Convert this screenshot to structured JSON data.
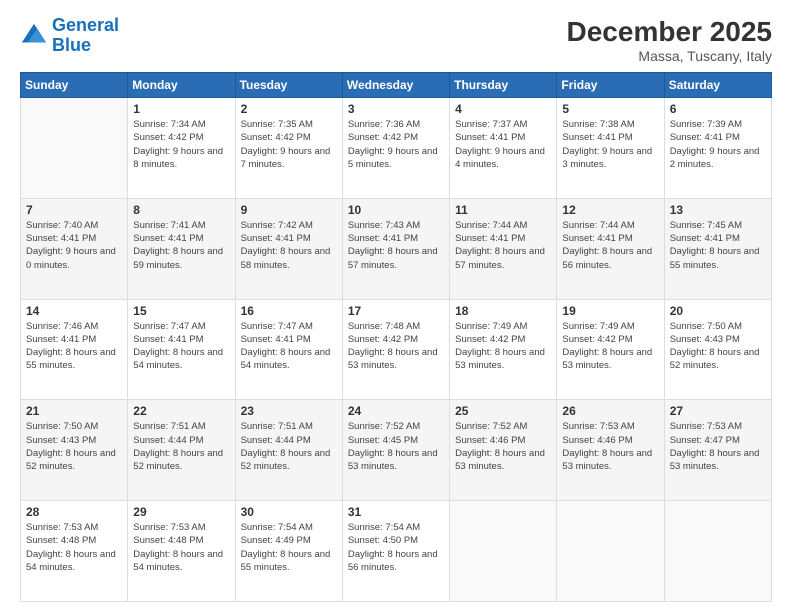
{
  "header": {
    "logo_line1": "General",
    "logo_line2": "Blue",
    "title": "December 2025",
    "subtitle": "Massa, Tuscany, Italy"
  },
  "days_of_week": [
    "Sunday",
    "Monday",
    "Tuesday",
    "Wednesday",
    "Thursday",
    "Friday",
    "Saturday"
  ],
  "weeks": [
    [
      {
        "day": "",
        "sunrise": "",
        "sunset": "",
        "daylight": ""
      },
      {
        "day": "1",
        "sunrise": "Sunrise: 7:34 AM",
        "sunset": "Sunset: 4:42 PM",
        "daylight": "Daylight: 9 hours and 8 minutes."
      },
      {
        "day": "2",
        "sunrise": "Sunrise: 7:35 AM",
        "sunset": "Sunset: 4:42 PM",
        "daylight": "Daylight: 9 hours and 7 minutes."
      },
      {
        "day": "3",
        "sunrise": "Sunrise: 7:36 AM",
        "sunset": "Sunset: 4:42 PM",
        "daylight": "Daylight: 9 hours and 5 minutes."
      },
      {
        "day": "4",
        "sunrise": "Sunrise: 7:37 AM",
        "sunset": "Sunset: 4:41 PM",
        "daylight": "Daylight: 9 hours and 4 minutes."
      },
      {
        "day": "5",
        "sunrise": "Sunrise: 7:38 AM",
        "sunset": "Sunset: 4:41 PM",
        "daylight": "Daylight: 9 hours and 3 minutes."
      },
      {
        "day": "6",
        "sunrise": "Sunrise: 7:39 AM",
        "sunset": "Sunset: 4:41 PM",
        "daylight": "Daylight: 9 hours and 2 minutes."
      }
    ],
    [
      {
        "day": "7",
        "sunrise": "Sunrise: 7:40 AM",
        "sunset": "Sunset: 4:41 PM",
        "daylight": "Daylight: 9 hours and 0 minutes."
      },
      {
        "day": "8",
        "sunrise": "Sunrise: 7:41 AM",
        "sunset": "Sunset: 4:41 PM",
        "daylight": "Daylight: 8 hours and 59 minutes."
      },
      {
        "day": "9",
        "sunrise": "Sunrise: 7:42 AM",
        "sunset": "Sunset: 4:41 PM",
        "daylight": "Daylight: 8 hours and 58 minutes."
      },
      {
        "day": "10",
        "sunrise": "Sunrise: 7:43 AM",
        "sunset": "Sunset: 4:41 PM",
        "daylight": "Daylight: 8 hours and 57 minutes."
      },
      {
        "day": "11",
        "sunrise": "Sunrise: 7:44 AM",
        "sunset": "Sunset: 4:41 PM",
        "daylight": "Daylight: 8 hours and 57 minutes."
      },
      {
        "day": "12",
        "sunrise": "Sunrise: 7:44 AM",
        "sunset": "Sunset: 4:41 PM",
        "daylight": "Daylight: 8 hours and 56 minutes."
      },
      {
        "day": "13",
        "sunrise": "Sunrise: 7:45 AM",
        "sunset": "Sunset: 4:41 PM",
        "daylight": "Daylight: 8 hours and 55 minutes."
      }
    ],
    [
      {
        "day": "14",
        "sunrise": "Sunrise: 7:46 AM",
        "sunset": "Sunset: 4:41 PM",
        "daylight": "Daylight: 8 hours and 55 minutes."
      },
      {
        "day": "15",
        "sunrise": "Sunrise: 7:47 AM",
        "sunset": "Sunset: 4:41 PM",
        "daylight": "Daylight: 8 hours and 54 minutes."
      },
      {
        "day": "16",
        "sunrise": "Sunrise: 7:47 AM",
        "sunset": "Sunset: 4:41 PM",
        "daylight": "Daylight: 8 hours and 54 minutes."
      },
      {
        "day": "17",
        "sunrise": "Sunrise: 7:48 AM",
        "sunset": "Sunset: 4:42 PM",
        "daylight": "Daylight: 8 hours and 53 minutes."
      },
      {
        "day": "18",
        "sunrise": "Sunrise: 7:49 AM",
        "sunset": "Sunset: 4:42 PM",
        "daylight": "Daylight: 8 hours and 53 minutes."
      },
      {
        "day": "19",
        "sunrise": "Sunrise: 7:49 AM",
        "sunset": "Sunset: 4:42 PM",
        "daylight": "Daylight: 8 hours and 53 minutes."
      },
      {
        "day": "20",
        "sunrise": "Sunrise: 7:50 AM",
        "sunset": "Sunset: 4:43 PM",
        "daylight": "Daylight: 8 hours and 52 minutes."
      }
    ],
    [
      {
        "day": "21",
        "sunrise": "Sunrise: 7:50 AM",
        "sunset": "Sunset: 4:43 PM",
        "daylight": "Daylight: 8 hours and 52 minutes."
      },
      {
        "day": "22",
        "sunrise": "Sunrise: 7:51 AM",
        "sunset": "Sunset: 4:44 PM",
        "daylight": "Daylight: 8 hours and 52 minutes."
      },
      {
        "day": "23",
        "sunrise": "Sunrise: 7:51 AM",
        "sunset": "Sunset: 4:44 PM",
        "daylight": "Daylight: 8 hours and 52 minutes."
      },
      {
        "day": "24",
        "sunrise": "Sunrise: 7:52 AM",
        "sunset": "Sunset: 4:45 PM",
        "daylight": "Daylight: 8 hours and 53 minutes."
      },
      {
        "day": "25",
        "sunrise": "Sunrise: 7:52 AM",
        "sunset": "Sunset: 4:46 PM",
        "daylight": "Daylight: 8 hours and 53 minutes."
      },
      {
        "day": "26",
        "sunrise": "Sunrise: 7:53 AM",
        "sunset": "Sunset: 4:46 PM",
        "daylight": "Daylight: 8 hours and 53 minutes."
      },
      {
        "day": "27",
        "sunrise": "Sunrise: 7:53 AM",
        "sunset": "Sunset: 4:47 PM",
        "daylight": "Daylight: 8 hours and 53 minutes."
      }
    ],
    [
      {
        "day": "28",
        "sunrise": "Sunrise: 7:53 AM",
        "sunset": "Sunset: 4:48 PM",
        "daylight": "Daylight: 8 hours and 54 minutes."
      },
      {
        "day": "29",
        "sunrise": "Sunrise: 7:53 AM",
        "sunset": "Sunset: 4:48 PM",
        "daylight": "Daylight: 8 hours and 54 minutes."
      },
      {
        "day": "30",
        "sunrise": "Sunrise: 7:54 AM",
        "sunset": "Sunset: 4:49 PM",
        "daylight": "Daylight: 8 hours and 55 minutes."
      },
      {
        "day": "31",
        "sunrise": "Sunrise: 7:54 AM",
        "sunset": "Sunset: 4:50 PM",
        "daylight": "Daylight: 8 hours and 56 minutes."
      },
      {
        "day": "",
        "sunrise": "",
        "sunset": "",
        "daylight": ""
      },
      {
        "day": "",
        "sunrise": "",
        "sunset": "",
        "daylight": ""
      },
      {
        "day": "",
        "sunrise": "",
        "sunset": "",
        "daylight": ""
      }
    ]
  ]
}
